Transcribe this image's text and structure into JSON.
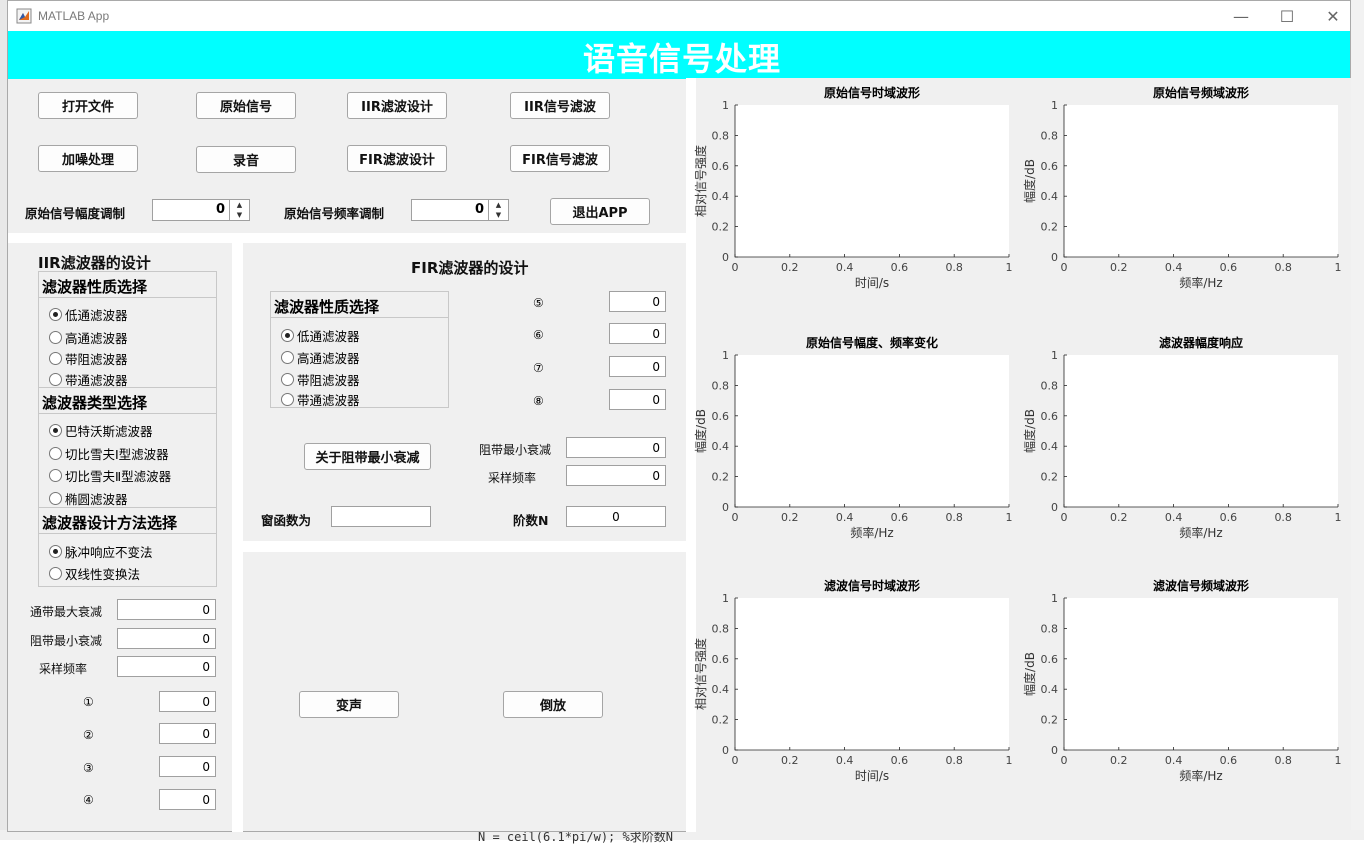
{
  "window": {
    "title": "MATLAB App",
    "minimize_glyph": "—",
    "maximize_glyph": "☐",
    "close_glyph": "✕"
  },
  "background": {
    "code_line": "N = ceil(6.1*pi/w); %求阶数N"
  },
  "app": {
    "title": "语音信号处理"
  },
  "toolbar": {
    "row1": [
      "打开文件",
      "原始信号",
      "IIR滤波设计",
      "IIR信号滤波"
    ],
    "row2": [
      "加噪处理",
      "录音",
      "FIR滤波设计",
      "FIR信号滤波"
    ],
    "amp_label": "原始信号幅度调制",
    "amp_value": "0",
    "freq_label": "原始信号频率调制",
    "freq_value": "0",
    "exit_label": "退出APP"
  },
  "iir": {
    "title": "IIR滤波器的设计",
    "nature_title": "滤波器性质选择",
    "nature_options": [
      "低通滤波器",
      "高通滤波器",
      "带阻滤波器",
      "带通滤波器"
    ],
    "type_title": "滤波器类型选择",
    "type_options": [
      "巴特沃斯滤波器",
      "切比雪夫Ⅰ型滤波器",
      "切比雪夫Ⅱ型滤波器",
      "椭圆滤波器"
    ],
    "method_title": "滤波器设计方法选择",
    "method_options": [
      "脉冲响应不变法",
      "双线性变换法"
    ],
    "pass_max_label": "通带最大衰减",
    "pass_max_value": "0",
    "stop_min_label": "阻带最小衰减",
    "stop_min_value": "0",
    "fs_label": "采样频率",
    "fs_value": "0",
    "params": [
      {
        "label": "①",
        "value": "0"
      },
      {
        "label": "②",
        "value": "0"
      },
      {
        "label": "③",
        "value": "0"
      },
      {
        "label": "④",
        "value": "0"
      }
    ]
  },
  "fir": {
    "title": "FIR滤波器的设计",
    "nature_title": "滤波器性质选择",
    "nature_options": [
      "低通滤波器",
      "高通滤波器",
      "带阻滤波器",
      "带通滤波器"
    ],
    "params": [
      {
        "label": "⑤",
        "value": "0"
      },
      {
        "label": "⑥",
        "value": "0"
      },
      {
        "label": "⑦",
        "value": "0"
      },
      {
        "label": "⑧",
        "value": "0"
      }
    ],
    "about_button": "关于阻带最小衰减",
    "stop_min_label": "阻带最小衰减",
    "stop_min_value": "0",
    "fs_label": "采样频率",
    "fs_value": "0",
    "window_label": "窗函数为",
    "window_value": "",
    "order_label": "阶数N",
    "order_value": "0"
  },
  "effects": {
    "voice_change": "变声",
    "reverse": "倒放"
  },
  "plots": [
    {
      "title": "原始信号时域波形",
      "xlabel": "时间/s",
      "ylabel": "相对信号强度"
    },
    {
      "title": "原始信号频域波形",
      "xlabel": "频率/Hz",
      "ylabel": "幅度/dB"
    },
    {
      "title": "原始信号幅度、频率变化",
      "xlabel": "频率/Hz",
      "ylabel": "幅度/dB"
    },
    {
      "title": "滤波器幅度响应",
      "xlabel": "频率/Hz",
      "ylabel": "幅度/dB"
    },
    {
      "title": "滤波信号时域波形",
      "xlabel": "时间/s",
      "ylabel": "相对信号强度"
    },
    {
      "title": "滤波信号频域波形",
      "xlabel": "频率/Hz",
      "ylabel": "幅度/dB"
    }
  ],
  "axis_ticks": {
    "x": [
      "0",
      "0.2",
      "0.4",
      "0.6",
      "0.8",
      "1"
    ],
    "y": [
      "0",
      "0.2",
      "0.4",
      "0.6",
      "0.8",
      "1"
    ]
  }
}
